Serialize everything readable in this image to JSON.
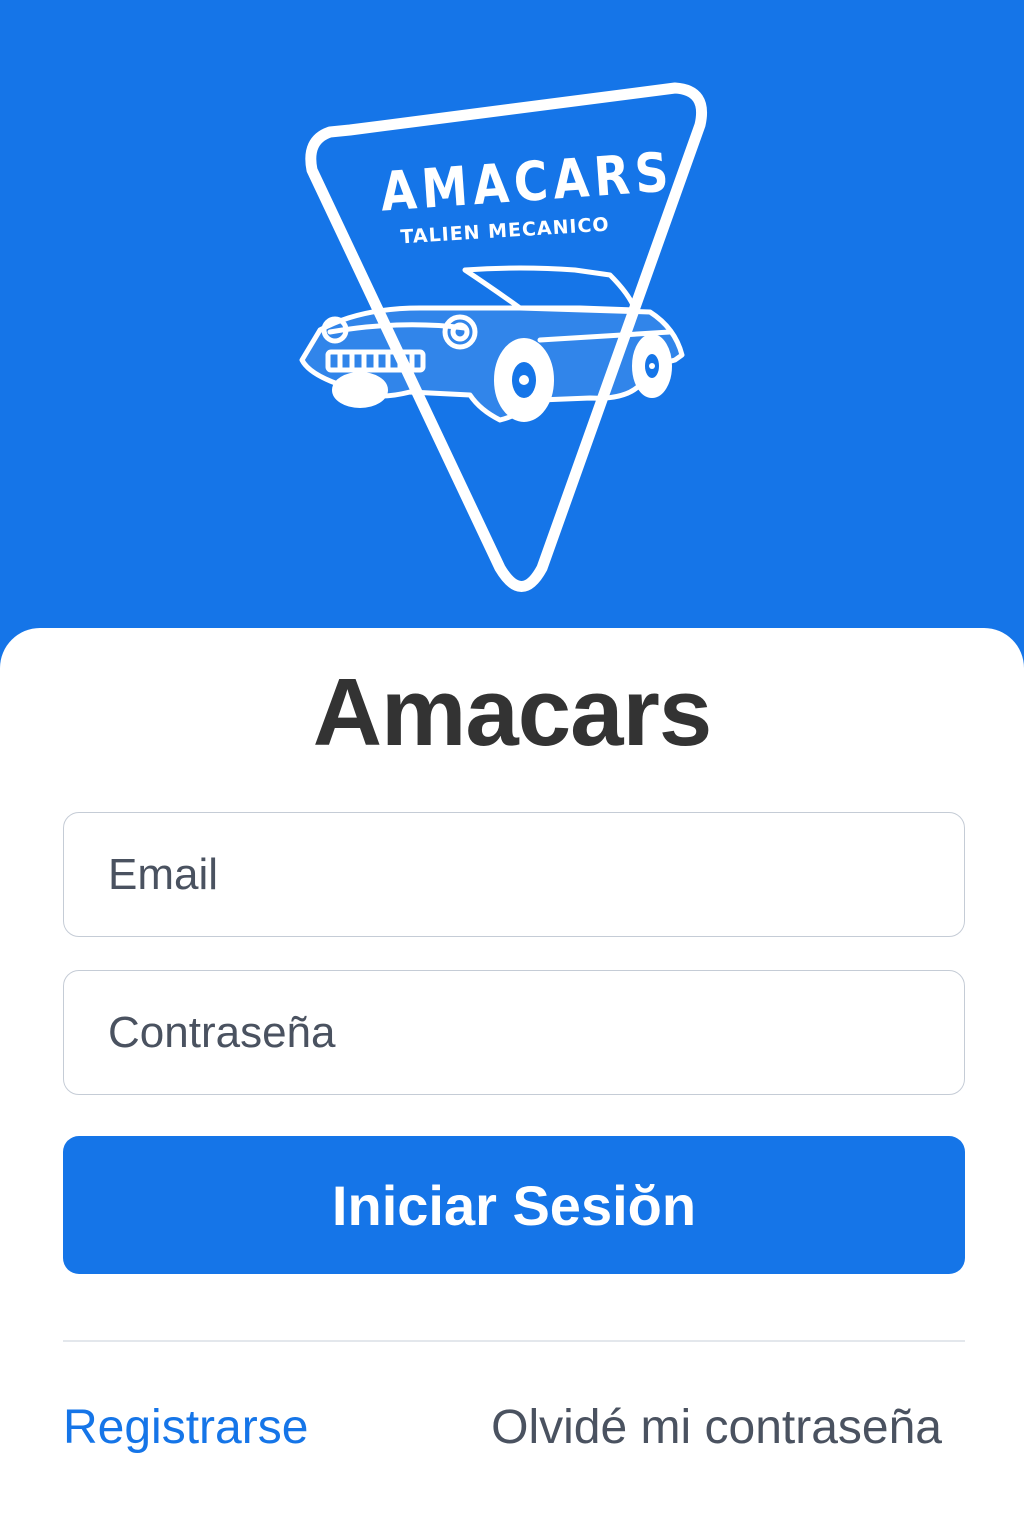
{
  "logo": {
    "brand": "AMACARS",
    "subtitle": "TALIEN MECANICO"
  },
  "app_title": "Amacars",
  "form": {
    "email_placeholder": "Email",
    "password_placeholder": "Contraseña",
    "submit_label": "Iniciar Sesiŏn"
  },
  "links": {
    "register": "Registrarse",
    "forgot_password": "Olvidé mi contraseña"
  },
  "colors": {
    "primary": "#1575e8",
    "title_text": "#333333",
    "muted_text": "#4a5260",
    "field_border": "#c5ccd6"
  }
}
